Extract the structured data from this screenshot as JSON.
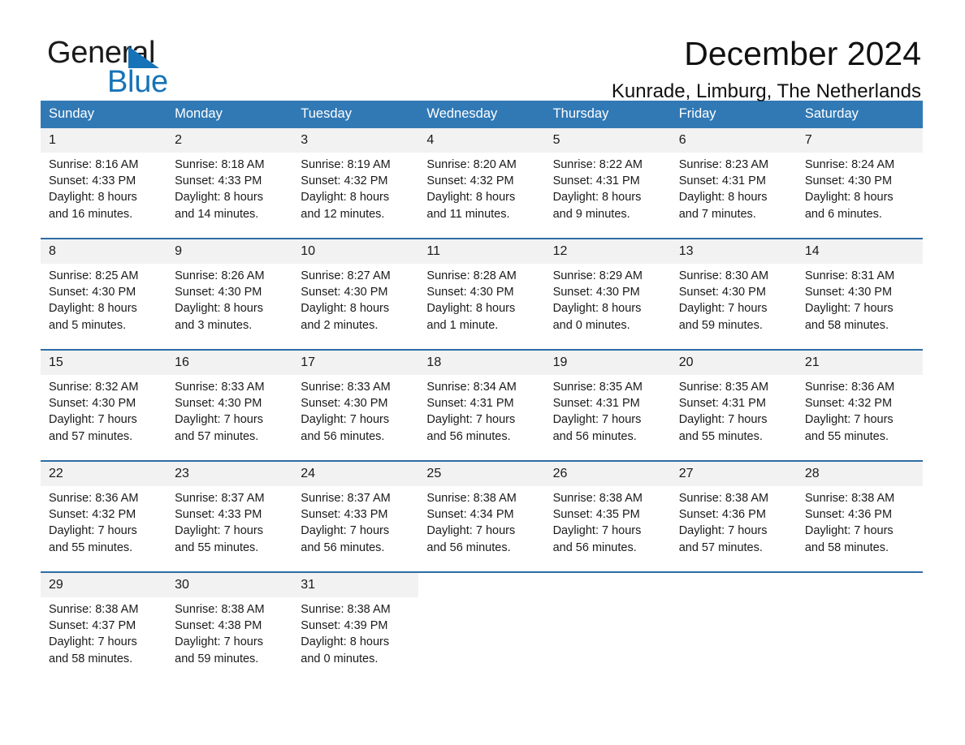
{
  "brand": {
    "name_part1": "General",
    "name_part2": "Blue",
    "logo_blue": "#1673b8"
  },
  "header": {
    "title": "December 2024",
    "location": "Kunrade, Limburg, The Netherlands",
    "header_bg": "#3179b5",
    "daynum_bg": "#f2f2f2",
    "week_rule_color": "#2e6da4"
  },
  "weekdays": [
    "Sunday",
    "Monday",
    "Tuesday",
    "Wednesday",
    "Thursday",
    "Friday",
    "Saturday"
  ],
  "labels": {
    "sunrise_prefix": "Sunrise:",
    "sunset_prefix": "Sunset:",
    "daylight_prefix": "Daylight:"
  },
  "weeks": [
    [
      {
        "day": "1",
        "sunrise": "Sunrise: 8:16 AM",
        "sunset": "Sunset: 4:33 PM",
        "daylight_line1": "Daylight: 8 hours",
        "daylight_line2": "and 16 minutes."
      },
      {
        "day": "2",
        "sunrise": "Sunrise: 8:18 AM",
        "sunset": "Sunset: 4:33 PM",
        "daylight_line1": "Daylight: 8 hours",
        "daylight_line2": "and 14 minutes."
      },
      {
        "day": "3",
        "sunrise": "Sunrise: 8:19 AM",
        "sunset": "Sunset: 4:32 PM",
        "daylight_line1": "Daylight: 8 hours",
        "daylight_line2": "and 12 minutes."
      },
      {
        "day": "4",
        "sunrise": "Sunrise: 8:20 AM",
        "sunset": "Sunset: 4:32 PM",
        "daylight_line1": "Daylight: 8 hours",
        "daylight_line2": "and 11 minutes."
      },
      {
        "day": "5",
        "sunrise": "Sunrise: 8:22 AM",
        "sunset": "Sunset: 4:31 PM",
        "daylight_line1": "Daylight: 8 hours",
        "daylight_line2": "and 9 minutes."
      },
      {
        "day": "6",
        "sunrise": "Sunrise: 8:23 AM",
        "sunset": "Sunset: 4:31 PM",
        "daylight_line1": "Daylight: 8 hours",
        "daylight_line2": "and 7 minutes."
      },
      {
        "day": "7",
        "sunrise": "Sunrise: 8:24 AM",
        "sunset": "Sunset: 4:30 PM",
        "daylight_line1": "Daylight: 8 hours",
        "daylight_line2": "and 6 minutes."
      }
    ],
    [
      {
        "day": "8",
        "sunrise": "Sunrise: 8:25 AM",
        "sunset": "Sunset: 4:30 PM",
        "daylight_line1": "Daylight: 8 hours",
        "daylight_line2": "and 5 minutes."
      },
      {
        "day": "9",
        "sunrise": "Sunrise: 8:26 AM",
        "sunset": "Sunset: 4:30 PM",
        "daylight_line1": "Daylight: 8 hours",
        "daylight_line2": "and 3 minutes."
      },
      {
        "day": "10",
        "sunrise": "Sunrise: 8:27 AM",
        "sunset": "Sunset: 4:30 PM",
        "daylight_line1": "Daylight: 8 hours",
        "daylight_line2": "and 2 minutes."
      },
      {
        "day": "11",
        "sunrise": "Sunrise: 8:28 AM",
        "sunset": "Sunset: 4:30 PM",
        "daylight_line1": "Daylight: 8 hours",
        "daylight_line2": "and 1 minute."
      },
      {
        "day": "12",
        "sunrise": "Sunrise: 8:29 AM",
        "sunset": "Sunset: 4:30 PM",
        "daylight_line1": "Daylight: 8 hours",
        "daylight_line2": "and 0 minutes."
      },
      {
        "day": "13",
        "sunrise": "Sunrise: 8:30 AM",
        "sunset": "Sunset: 4:30 PM",
        "daylight_line1": "Daylight: 7 hours",
        "daylight_line2": "and 59 minutes."
      },
      {
        "day": "14",
        "sunrise": "Sunrise: 8:31 AM",
        "sunset": "Sunset: 4:30 PM",
        "daylight_line1": "Daylight: 7 hours",
        "daylight_line2": "and 58 minutes."
      }
    ],
    [
      {
        "day": "15",
        "sunrise": "Sunrise: 8:32 AM",
        "sunset": "Sunset: 4:30 PM",
        "daylight_line1": "Daylight: 7 hours",
        "daylight_line2": "and 57 minutes."
      },
      {
        "day": "16",
        "sunrise": "Sunrise: 8:33 AM",
        "sunset": "Sunset: 4:30 PM",
        "daylight_line1": "Daylight: 7 hours",
        "daylight_line2": "and 57 minutes."
      },
      {
        "day": "17",
        "sunrise": "Sunrise: 8:33 AM",
        "sunset": "Sunset: 4:30 PM",
        "daylight_line1": "Daylight: 7 hours",
        "daylight_line2": "and 56 minutes."
      },
      {
        "day": "18",
        "sunrise": "Sunrise: 8:34 AM",
        "sunset": "Sunset: 4:31 PM",
        "daylight_line1": "Daylight: 7 hours",
        "daylight_line2": "and 56 minutes."
      },
      {
        "day": "19",
        "sunrise": "Sunrise: 8:35 AM",
        "sunset": "Sunset: 4:31 PM",
        "daylight_line1": "Daylight: 7 hours",
        "daylight_line2": "and 56 minutes."
      },
      {
        "day": "20",
        "sunrise": "Sunrise: 8:35 AM",
        "sunset": "Sunset: 4:31 PM",
        "daylight_line1": "Daylight: 7 hours",
        "daylight_line2": "and 55 minutes."
      },
      {
        "day": "21",
        "sunrise": "Sunrise: 8:36 AM",
        "sunset": "Sunset: 4:32 PM",
        "daylight_line1": "Daylight: 7 hours",
        "daylight_line2": "and 55 minutes."
      }
    ],
    [
      {
        "day": "22",
        "sunrise": "Sunrise: 8:36 AM",
        "sunset": "Sunset: 4:32 PM",
        "daylight_line1": "Daylight: 7 hours",
        "daylight_line2": "and 55 minutes."
      },
      {
        "day": "23",
        "sunrise": "Sunrise: 8:37 AM",
        "sunset": "Sunset: 4:33 PM",
        "daylight_line1": "Daylight: 7 hours",
        "daylight_line2": "and 55 minutes."
      },
      {
        "day": "24",
        "sunrise": "Sunrise: 8:37 AM",
        "sunset": "Sunset: 4:33 PM",
        "daylight_line1": "Daylight: 7 hours",
        "daylight_line2": "and 56 minutes."
      },
      {
        "day": "25",
        "sunrise": "Sunrise: 8:38 AM",
        "sunset": "Sunset: 4:34 PM",
        "daylight_line1": "Daylight: 7 hours",
        "daylight_line2": "and 56 minutes."
      },
      {
        "day": "26",
        "sunrise": "Sunrise: 8:38 AM",
        "sunset": "Sunset: 4:35 PM",
        "daylight_line1": "Daylight: 7 hours",
        "daylight_line2": "and 56 minutes."
      },
      {
        "day": "27",
        "sunrise": "Sunrise: 8:38 AM",
        "sunset": "Sunset: 4:36 PM",
        "daylight_line1": "Daylight: 7 hours",
        "daylight_line2": "and 57 minutes."
      },
      {
        "day": "28",
        "sunrise": "Sunrise: 8:38 AM",
        "sunset": "Sunset: 4:36 PM",
        "daylight_line1": "Daylight: 7 hours",
        "daylight_line2": "and 58 minutes."
      }
    ],
    [
      {
        "day": "29",
        "sunrise": "Sunrise: 8:38 AM",
        "sunset": "Sunset: 4:37 PM",
        "daylight_line1": "Daylight: 7 hours",
        "daylight_line2": "and 58 minutes."
      },
      {
        "day": "30",
        "sunrise": "Sunrise: 8:38 AM",
        "sunset": "Sunset: 4:38 PM",
        "daylight_line1": "Daylight: 7 hours",
        "daylight_line2": "and 59 minutes."
      },
      {
        "day": "31",
        "sunrise": "Sunrise: 8:38 AM",
        "sunset": "Sunset: 4:39 PM",
        "daylight_line1": "Daylight: 8 hours",
        "daylight_line2": "and 0 minutes."
      },
      {
        "day": "",
        "sunrise": "",
        "sunset": "",
        "daylight_line1": "",
        "daylight_line2": ""
      },
      {
        "day": "",
        "sunrise": "",
        "sunset": "",
        "daylight_line1": "",
        "daylight_line2": ""
      },
      {
        "day": "",
        "sunrise": "",
        "sunset": "",
        "daylight_line1": "",
        "daylight_line2": ""
      },
      {
        "day": "",
        "sunrise": "",
        "sunset": "",
        "daylight_line1": "",
        "daylight_line2": ""
      }
    ]
  ]
}
